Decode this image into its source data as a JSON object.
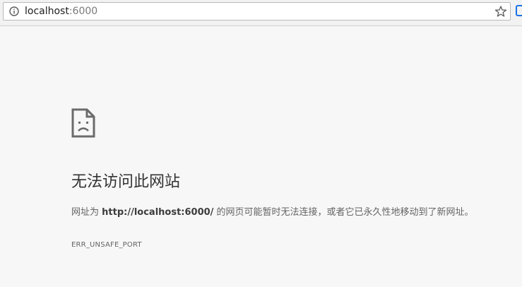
{
  "address_bar": {
    "host": "localhost",
    "port": ":6000"
  },
  "icons": {
    "info": "info-icon",
    "bookmark": "star-icon",
    "page_error": "sad-document-icon"
  },
  "error_page": {
    "title": "无法访问此网站",
    "description_prefix": "网址为 ",
    "url": "http://localhost:6000/",
    "description_suffix": " 的网页可能暂时无法连接，或者它已永久性地移动到了新网址。",
    "error_code": "ERR_UNSAFE_PORT"
  }
}
